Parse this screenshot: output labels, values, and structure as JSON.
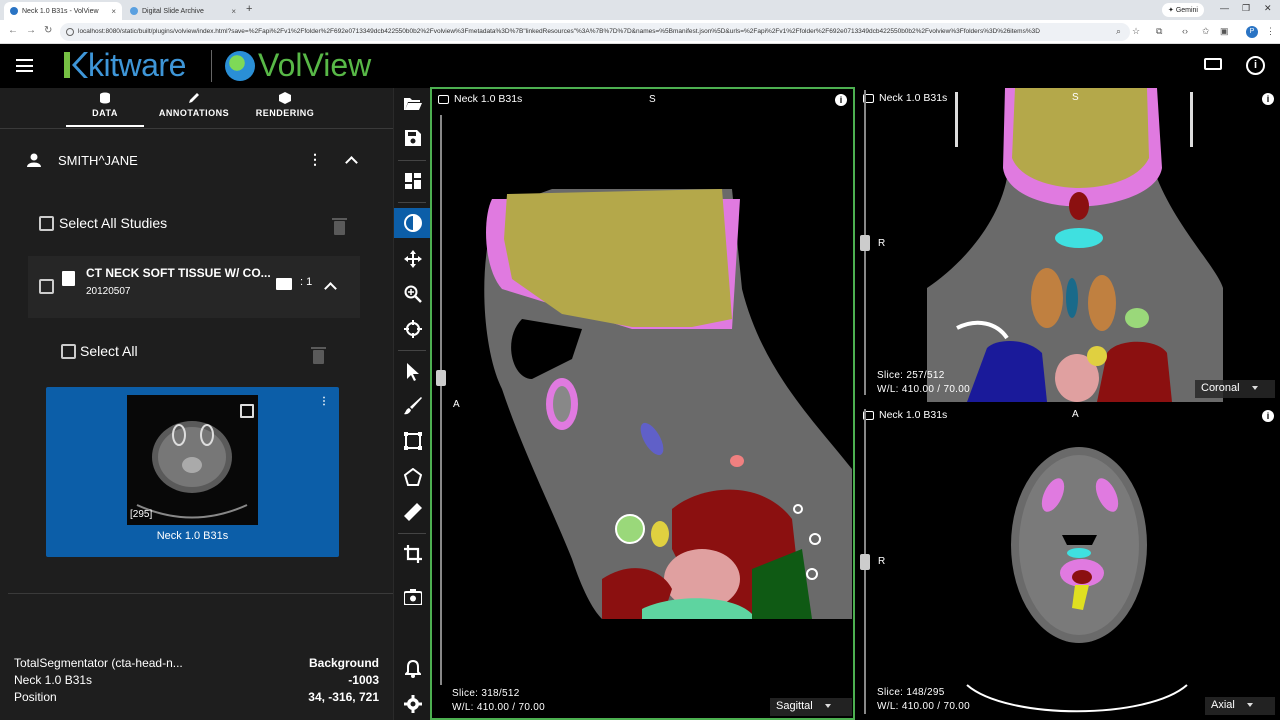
{
  "browser": {
    "tabs": [
      {
        "title": "Neck 1.0 B31s - VolView",
        "active": true
      },
      {
        "title": "Digital Slide Archive",
        "active": false
      }
    ],
    "new_tab": "+",
    "gemini_label": "Gemini",
    "url": "localhost:8080/static/built/plugins/volview/index.html?save=%2Fapi%2Fv1%2Ffolder%2F692e0713349dcb422550b0b2%2Fvolview%3Fmetadata%3D%7B\"linkedResources\"%3A%7B%7D%7D&names=%5Bmanifest.json%5D&urls=%2Fapi%2Fv1%2Ffolder%2F692e0713349dcb422550b0b2%2Fvolview%3Ffolders%3D%26items%3D"
  },
  "app": {
    "brand_kitware": "kitware",
    "brand_volview": "VolView"
  },
  "left_panel": {
    "tabs": [
      {
        "label": "DATA",
        "icon": "database-icon"
      },
      {
        "label": "ANNOTATIONS",
        "icon": "pencil-icon"
      },
      {
        "label": "RENDERING",
        "icon": "cube-icon"
      }
    ],
    "patient_name": "SMITH^JANE",
    "select_all_studies": "Select All Studies",
    "study": {
      "title": "CT NECK SOFT TISSUE W/ CO...",
      "date": "20120507",
      "series_count": ": 1"
    },
    "select_all": "Select All",
    "series": {
      "name": "Neck 1.0 B31s",
      "slice_count": "[295]"
    },
    "info_rows": [
      {
        "key": "TotalSegmentator (cta-head-n...",
        "value": "Background"
      },
      {
        "key": "Neck 1.0 B31s",
        "value": "-1003"
      },
      {
        "key": "Position",
        "value": "34, -316, 721"
      }
    ]
  },
  "viewports": {
    "sagittal": {
      "name": "Neck 1.0 B31s",
      "top_label": "S",
      "left_label": "A",
      "slice": "Slice: 318/512",
      "wl": "W/L: 410.00 / 70.00",
      "view": "Sagittal",
      "slider_position": 0.46
    },
    "coronal": {
      "name": "Neck 1.0 B31s",
      "top_label": "S",
      "left_label": "R",
      "slice": "Slice: 257/512",
      "wl": "W/L: 410.00 / 70.00",
      "view": "Coronal",
      "slider_position": 0.5
    },
    "axial": {
      "name": "Neck 1.0 B31s",
      "top_label": "A",
      "left_label": "R",
      "slice": "Slice: 148/295",
      "wl": "W/L: 410.00 / 70.00",
      "view": "Axial",
      "slider_position": 0.5
    }
  },
  "colors": {
    "accent": "#0c5ea8",
    "active_border": "#4caf50",
    "brain": "#b4a84a",
    "skull": "#e07ae0",
    "heart": "#8b1010",
    "lung": "#1a3a9a"
  }
}
